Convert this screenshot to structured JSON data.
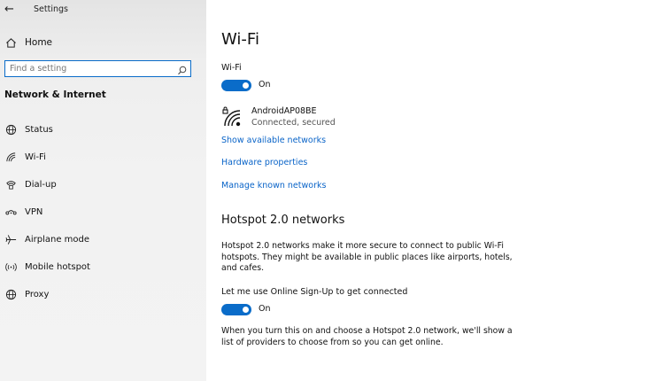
{
  "window": {
    "title": "Settings",
    "back_glyph": "←"
  },
  "sidebar": {
    "home_label": "Home",
    "search_placeholder": "Find a setting",
    "section_title": "Network & Internet",
    "items": [
      {
        "label": "Status",
        "icon": "globe-icon"
      },
      {
        "label": "Wi-Fi",
        "icon": "wifi-icon"
      },
      {
        "label": "Dial-up",
        "icon": "phone-icon"
      },
      {
        "label": "VPN",
        "icon": "vpn-icon"
      },
      {
        "label": "Airplane mode",
        "icon": "airplane-icon"
      },
      {
        "label": "Mobile hotspot",
        "icon": "hotspot-icon"
      },
      {
        "label": "Proxy",
        "icon": "globe-icon"
      }
    ]
  },
  "main": {
    "page_title": "Wi-Fi",
    "wifi_label": "Wi-Fi",
    "wifi_toggle": {
      "state": "On",
      "on": true
    },
    "network": {
      "name": "AndroidAP08BE",
      "status": "Connected, secured"
    },
    "links": [
      "Show available networks",
      "Hardware properties",
      "Manage known networks"
    ],
    "hotspot": {
      "title": "Hotspot 2.0 networks",
      "description": "Hotspot 2.0 networks make it more secure to connect to public Wi-Fi hotspots. They might be available in public places like airports, hotels, and cafes.",
      "signup_label": "Let me use Online Sign-Up to get connected",
      "signup_toggle": {
        "state": "On",
        "on": true
      },
      "footer": "When you turn this on and choose a Hotspot 2.0 network, we'll show a list of providers to choose from so you can get online."
    }
  },
  "colors": {
    "accent": "#0a6cc9",
    "link": "#0a64c8",
    "sidebar_bg": "#f3f3f3"
  }
}
